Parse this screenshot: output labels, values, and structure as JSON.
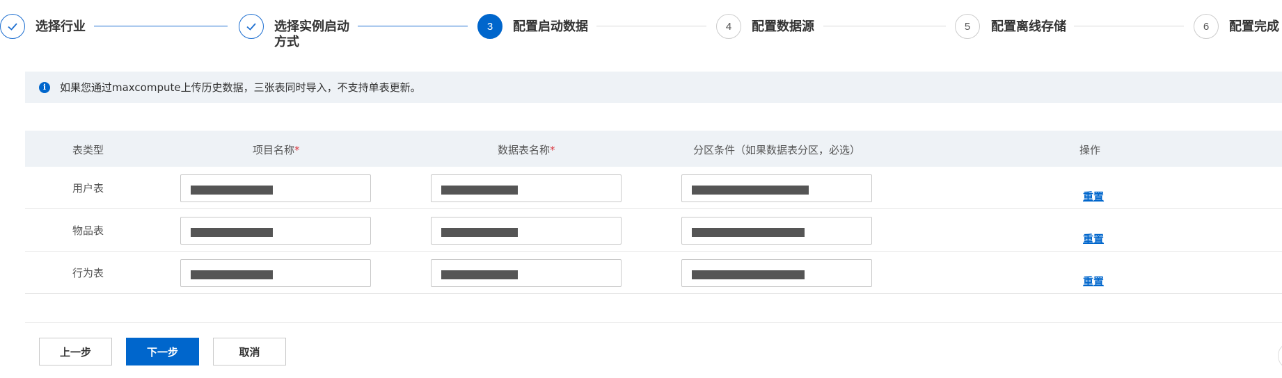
{
  "steps": [
    {
      "label": "选择行业",
      "state": "done"
    },
    {
      "label_line1": "选择实例启动",
      "label_line2": "方式",
      "state": "done"
    },
    {
      "number": "3",
      "label": "配置启动数据",
      "state": "active"
    },
    {
      "number": "4",
      "label": "配置数据源",
      "state": "todo"
    },
    {
      "number": "5",
      "label": "配置离线存储",
      "state": "todo"
    },
    {
      "number": "6",
      "label": "配置完成",
      "state": "todo"
    }
  ],
  "notice": {
    "icon": "info-icon",
    "text": "如果您通过maxcompute上传历史数据，三张表同时导入，不支持单表更新。"
  },
  "table": {
    "headers": {
      "type": "表类型",
      "project": "项目名称",
      "table_name": "数据表名称",
      "partition": "分区条件（如果数据表分区，必选）",
      "action": "操作",
      "required_mark": "*"
    },
    "rows": [
      {
        "type": "用户表",
        "action": "重置"
      },
      {
        "type": "物品表",
        "action": "重置"
      },
      {
        "type": "行为表",
        "action": "重置"
      }
    ]
  },
  "buttons": {
    "prev": "上一步",
    "next": "下一步",
    "cancel": "取消"
  },
  "colors": {
    "accent": "#0066cc",
    "header_bg": "#eef2f6",
    "required": "#d9363e"
  }
}
